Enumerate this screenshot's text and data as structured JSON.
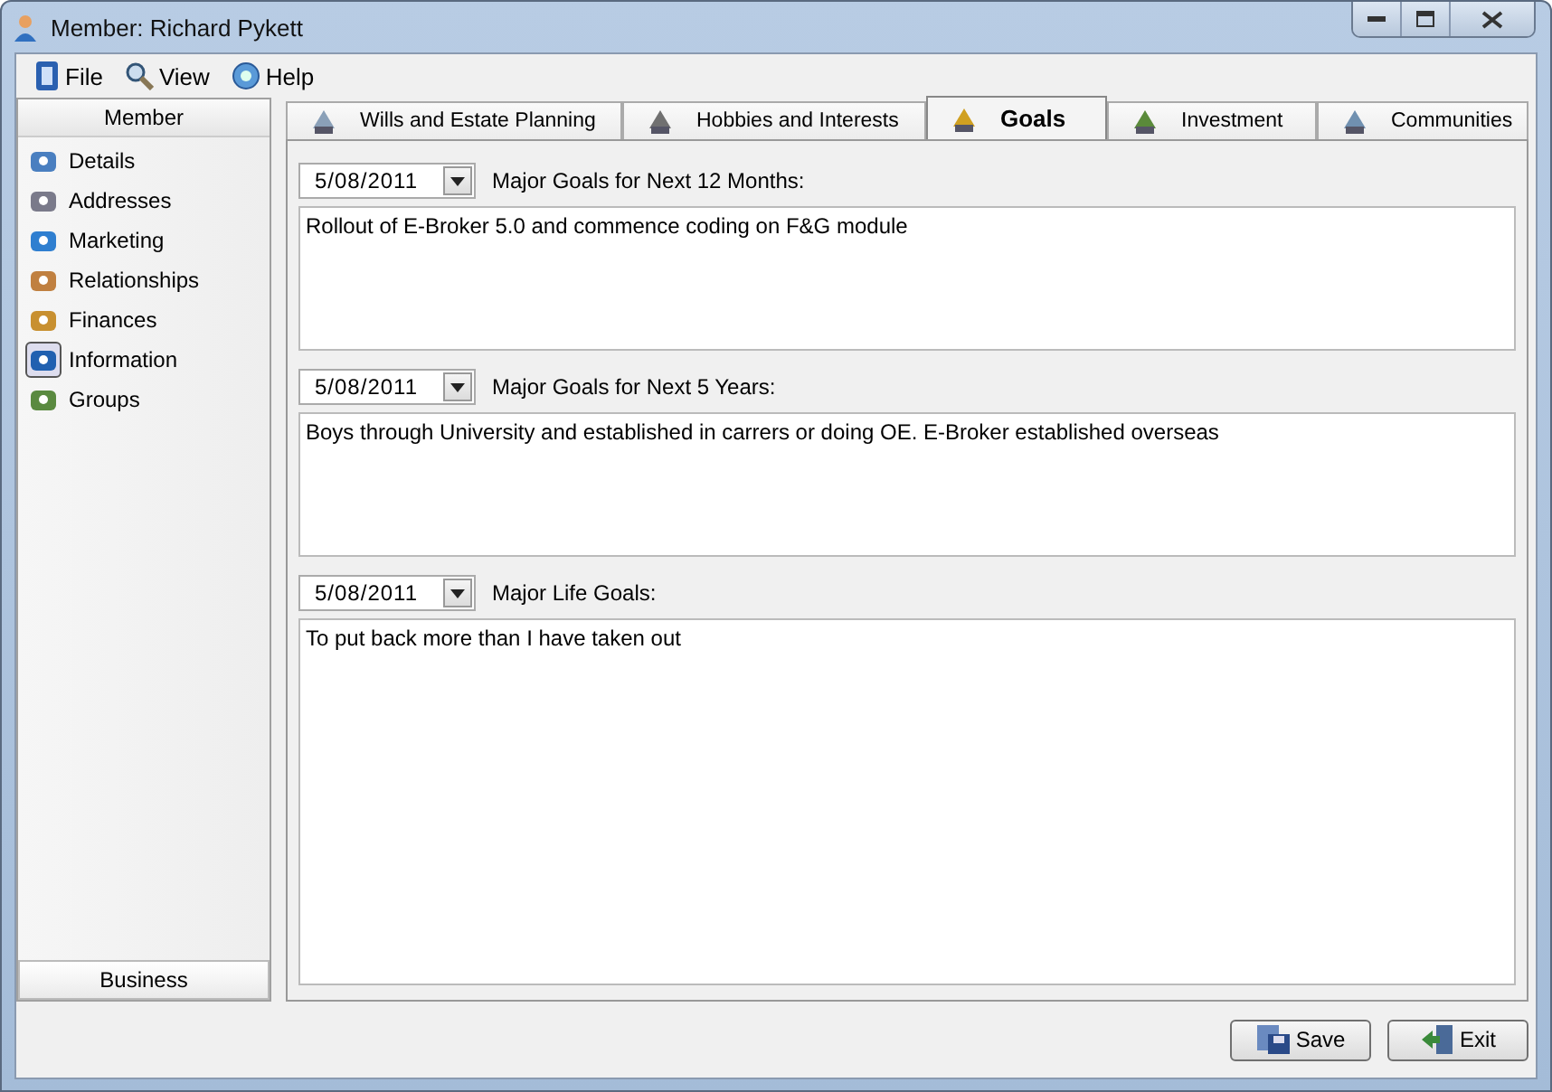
{
  "window": {
    "title": "Member: Richard Pykett"
  },
  "menu": [
    "File",
    "View",
    "Help"
  ],
  "sidebar": {
    "header": "Member",
    "items": [
      {
        "label": "Details",
        "selected": false
      },
      {
        "label": "Addresses",
        "selected": false
      },
      {
        "label": "Marketing",
        "selected": false
      },
      {
        "label": "Relationships",
        "selected": false
      },
      {
        "label": "Finances",
        "selected": false
      },
      {
        "label": "Information",
        "selected": true
      },
      {
        "label": "Groups",
        "selected": false
      }
    ],
    "footer": "Business"
  },
  "tabs": [
    {
      "label": "Wills and Estate Planning",
      "selected": false
    },
    {
      "label": "Hobbies and Interests",
      "selected": false
    },
    {
      "label": "Goals",
      "selected": true
    },
    {
      "label": "Investment",
      "selected": false
    },
    {
      "label": "Communities",
      "selected": false
    }
  ],
  "goals": [
    {
      "date": "5/08/2011",
      "label": "Major Goals for Next 12 Months:",
      "text": "Rollout of E-Broker 5.0 and commence coding on F&G module"
    },
    {
      "date": "5/08/2011",
      "label": "Major Goals for Next 5 Years:",
      "text": "Boys through University and established in carrers or doing OE. E-Broker established overseas"
    },
    {
      "date": "5/08/2011",
      "label": "Major Life Goals:",
      "text": "To put back more than I have taken out"
    }
  ],
  "buttons": [
    "Save",
    "Exit"
  ]
}
